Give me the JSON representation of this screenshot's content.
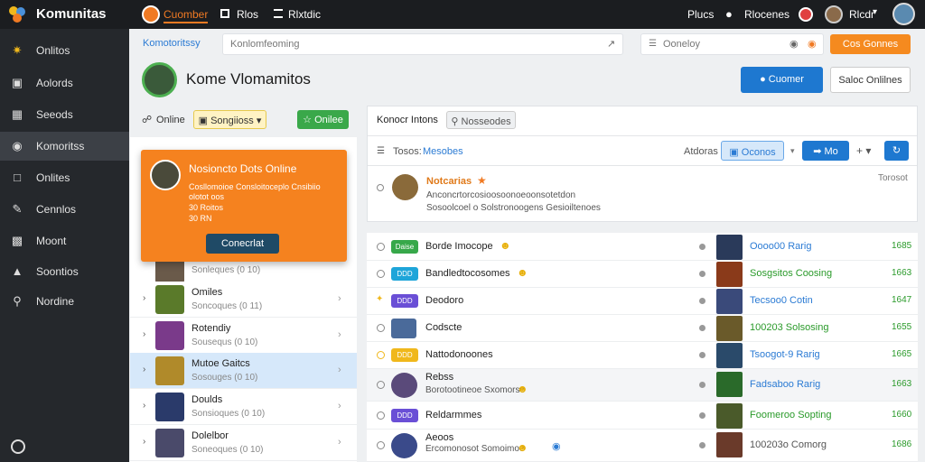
{
  "topbar": {
    "brand": "Komunitas",
    "tab_active": "Cuomber",
    "tab2": "Rlos",
    "tab3": "Rlxtdic",
    "right1": "Plucs",
    "right2": "Rlocenes",
    "right3": "Rlcdr"
  },
  "sidebar": {
    "items": [
      {
        "label": "Onlitos",
        "icon": "puzzle-icon"
      },
      {
        "label": "Aolords",
        "icon": "square-icon"
      },
      {
        "label": "Seeods",
        "icon": "grid-icon"
      },
      {
        "label": "Komoritss",
        "icon": "eye-icon"
      },
      {
        "label": "Onlites",
        "icon": "square-icon"
      },
      {
        "label": "Cennlos",
        "icon": "pencil-icon"
      },
      {
        "label": "Moont",
        "icon": "joystick-icon"
      },
      {
        "label": "Soontios",
        "icon": "folder-icon"
      },
      {
        "label": "Nordine",
        "icon": "search-icon"
      }
    ]
  },
  "search": {
    "label": "Komotoritssy",
    "placeholder": "Konlomfeoming",
    "second_placeholder": "Ooneloy",
    "orange_btn": "Cos Gonnes"
  },
  "profile": {
    "title": "Kome Vlomamitos",
    "primary_btn": "Cuomer",
    "secondary_btn": "Saloc Onlilnes"
  },
  "left_panel": {
    "online_label": "Online",
    "dropdown_label": "Songiioss",
    "green_btn": "Onilee",
    "popup": {
      "title": "Nosioncto Dots Online",
      "line1": "Cosllomoioe Consloitoceplo Cnsibiio",
      "line2": "olotot oos",
      "line3": "30 Roitos",
      "line4": "30 RN",
      "button": "Conecrlat"
    },
    "rows": [
      {
        "name": "",
        "sub": "Sonleques (0 10)"
      },
      {
        "name": "Omiles",
        "sub": "Soncoques (0 11)"
      },
      {
        "name": "Rotendiy",
        "sub": "Sousequs (0 10)"
      },
      {
        "name": "Mutoe Gaitcs",
        "sub": "Sosouges (0 10)"
      },
      {
        "name": "Doulds",
        "sub": "Sonsioques (0 10)"
      },
      {
        "name": "Dolelbor",
        "sub": "Soneoques (0 10)"
      }
    ]
  },
  "right_panel": {
    "tab1": "Konocr Intons",
    "tab2": "Nosseodes",
    "toolbar_label": "Tosos:",
    "toolbar_value": "Mesobes",
    "toolbar_right_label": "Atdoras",
    "view_btn": "Oconos",
    "blue_btn": "Mo",
    "notice": {
      "title": "Notcarias",
      "line1": "Anconcrtorcosioosoonoeoonsotetdon",
      "line2": "Sosoolcoel o Solstronoogens Gesioiltenoes",
      "meta": "Torosot"
    },
    "rows": [
      {
        "name": "Borde Imocope",
        "tag": "Daise",
        "tag_color": "#37a84a",
        "mid": "Oooo00 Rarig",
        "mid_color": "#2b7bd4",
        "num": "1685"
      },
      {
        "name": "Bandledtocosomes",
        "tag": "DDD",
        "tag_color": "#1ea5d9",
        "mid": "Sosgsitos Coosing",
        "mid_color": "#2a9a2a",
        "num": "1663"
      },
      {
        "name": "Deodoro",
        "tag": "DDD",
        "tag_color": "#6a4fd6",
        "mid": "Tecsoo0 Cotin",
        "mid_color": "#2b7bd4",
        "num": "1647"
      },
      {
        "name": "Codscte",
        "tag": "",
        "tag_color": "",
        "mid": "100203 Solsosing",
        "mid_color": "#2a9a2a",
        "num": "1655"
      },
      {
        "name": "Nattodonoones",
        "tag": "DDD",
        "tag_color": "#f0b81c",
        "mid": "Tsoogot-9 Rarig",
        "mid_color": "#2b7bd4",
        "num": "1665"
      },
      {
        "name": "Rebss",
        "sub": "Borotootineoe Sxomorse",
        "tag": "",
        "tag_color": "",
        "mid": "Fadsaboo Rarig",
        "mid_color": "#2b7bd4",
        "num": "1663"
      },
      {
        "name": "Reldarmmes",
        "tag": "DDD",
        "tag_color": "#6a4fd6",
        "mid": "Foomeroo Sopting",
        "mid_color": "#2a9a2a",
        "num": "1660"
      },
      {
        "name": "Aeoos",
        "sub": "Ercomonosot Somoimoe",
        "tag": "",
        "tag_color": "",
        "mid": "100203o Comorg",
        "mid_color": "#555555",
        "num": "1686"
      }
    ]
  }
}
